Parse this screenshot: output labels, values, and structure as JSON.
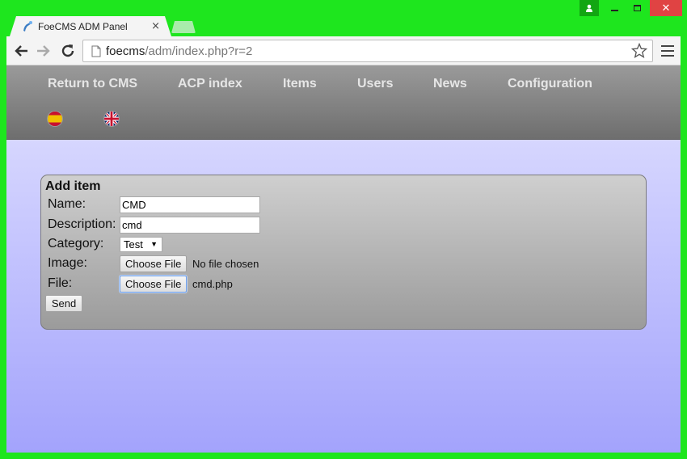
{
  "browser": {
    "tab_title": "FoeCMS ADM Panel",
    "tab_close": "×",
    "url_host": "foecms",
    "url_path": "/adm/index.php?r=2",
    "window_close": "✕"
  },
  "nav": {
    "links": [
      "Return to CMS",
      "ACP index",
      "Items",
      "Users",
      "News",
      "Configuration"
    ],
    "languages": [
      "spanish-flag-icon",
      "uk-flag-icon"
    ]
  },
  "form": {
    "title": "Add item",
    "name_label": "Name:",
    "name_value": "CMD",
    "description_label": "Description:",
    "description_value": "cmd",
    "category_label": "Category:",
    "category_value": "Test",
    "image_label": "Image:",
    "image_button": "Choose File",
    "image_status": "No file chosen",
    "file_label": "File:",
    "file_button": "Choose File",
    "file_status": "cmd.php",
    "send_label": "Send"
  },
  "colors": {
    "frame": "#1ee61e",
    "navbar_top": "#9a9a9a",
    "navbar_bottom": "#6e6e6e",
    "page_top": "#e2e2ff",
    "page_bottom": "#a3a3fc"
  }
}
